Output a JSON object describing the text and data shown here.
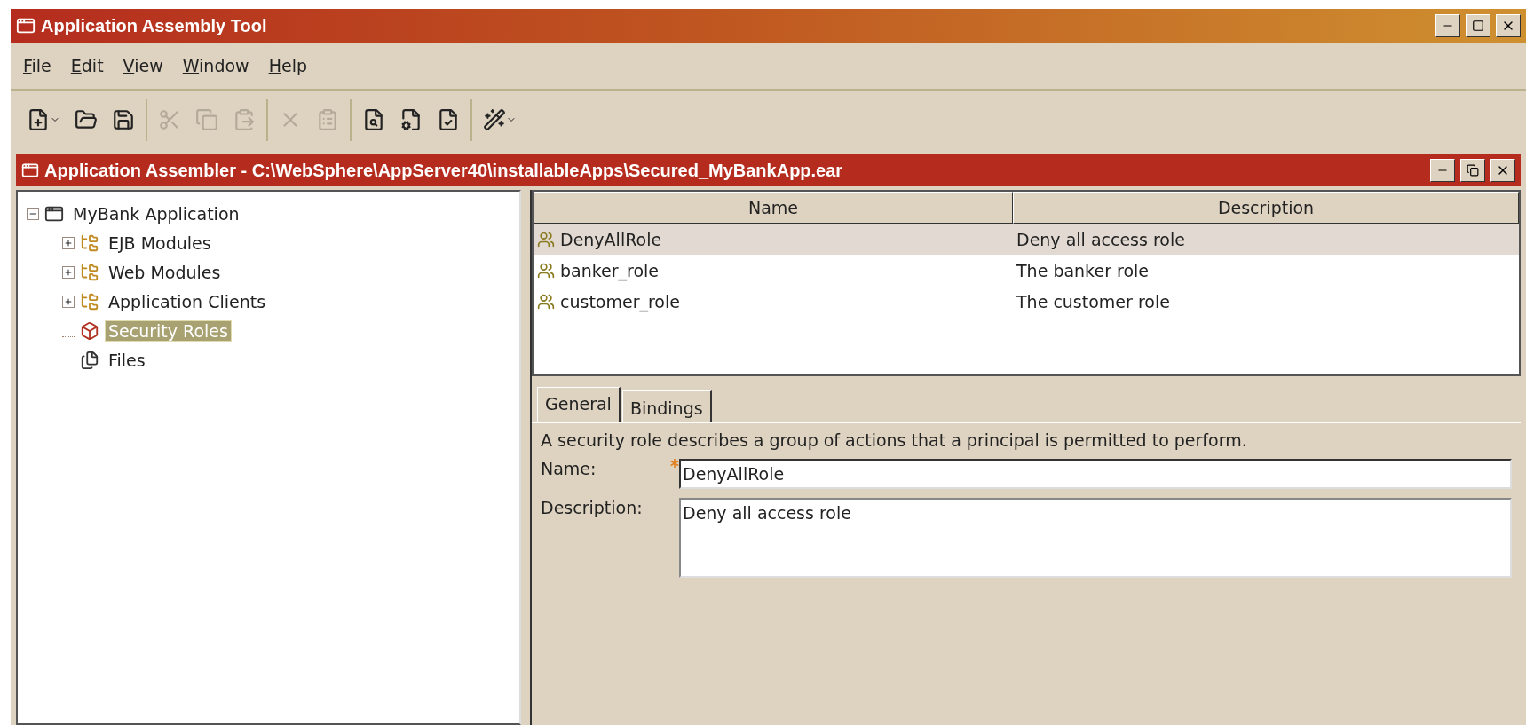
{
  "window": {
    "title": "Application Assembly Tool"
  },
  "menu": [
    "File",
    "Edit",
    "View",
    "Window",
    "Help"
  ],
  "toolbar": [
    [
      {
        "kind": "new",
        "disabled": false,
        "dropdown": true
      },
      {
        "kind": "open",
        "disabled": false,
        "dropdown": false
      },
      {
        "kind": "save",
        "disabled": false,
        "dropdown": false
      }
    ],
    [
      {
        "kind": "cut",
        "disabled": true,
        "dropdown": false
      },
      {
        "kind": "copy",
        "disabled": true,
        "dropdown": false
      },
      {
        "kind": "paste",
        "disabled": true,
        "dropdown": false
      }
    ],
    [
      {
        "kind": "delete",
        "disabled": true,
        "dropdown": false
      },
      {
        "kind": "properties",
        "disabled": true,
        "dropdown": false
      }
    ],
    [
      {
        "kind": "search",
        "disabled": false,
        "dropdown": false
      },
      {
        "kind": "generate",
        "disabled": false,
        "dropdown": false
      },
      {
        "kind": "verify",
        "disabled": false,
        "dropdown": false
      }
    ],
    [
      {
        "kind": "wizard",
        "disabled": false,
        "dropdown": true
      }
    ]
  ],
  "inner_window": {
    "title": "Application Assembler - C:\\WebSphere\\AppServer40\\installableApps\\Secured_MyBankApp.ear"
  },
  "tree": [
    {
      "label": "MyBank Application",
      "kind": "app",
      "expanded": true,
      "selected": false,
      "children": [
        {
          "label": "EJB Modules",
          "kind": "modules",
          "expanded": false,
          "selected": false
        },
        {
          "label": "Web Modules",
          "kind": "modules",
          "expanded": false,
          "selected": false
        },
        {
          "label": "Application Clients",
          "kind": "modules",
          "expanded": false,
          "selected": false
        },
        {
          "label": "Security Roles",
          "kind": "roles",
          "selected": true
        },
        {
          "label": "Files",
          "kind": "files",
          "selected": false
        }
      ]
    }
  ],
  "table": {
    "columns": [
      "Name",
      "Description"
    ],
    "rows": [
      {
        "cells": [
          "DenyAllRole",
          "Deny all access role"
        ],
        "selected": true
      },
      {
        "cells": [
          "banker_role",
          "The banker role"
        ],
        "selected": false
      },
      {
        "cells": [
          "customer_role",
          "The customer role"
        ],
        "selected": false
      }
    ]
  },
  "tabs": [
    {
      "label": "General",
      "selected": true
    },
    {
      "label": "Bindings",
      "selected": false
    }
  ],
  "form": {
    "intro": "A security role describes a group of actions that a principal is permitted to perform.",
    "fields": [
      {
        "label": "Name:",
        "value": "DenyAllRole",
        "kind": "line",
        "required": true
      },
      {
        "label": "Description:",
        "value": "Deny all access role",
        "kind": "area",
        "required": false
      }
    ]
  }
}
